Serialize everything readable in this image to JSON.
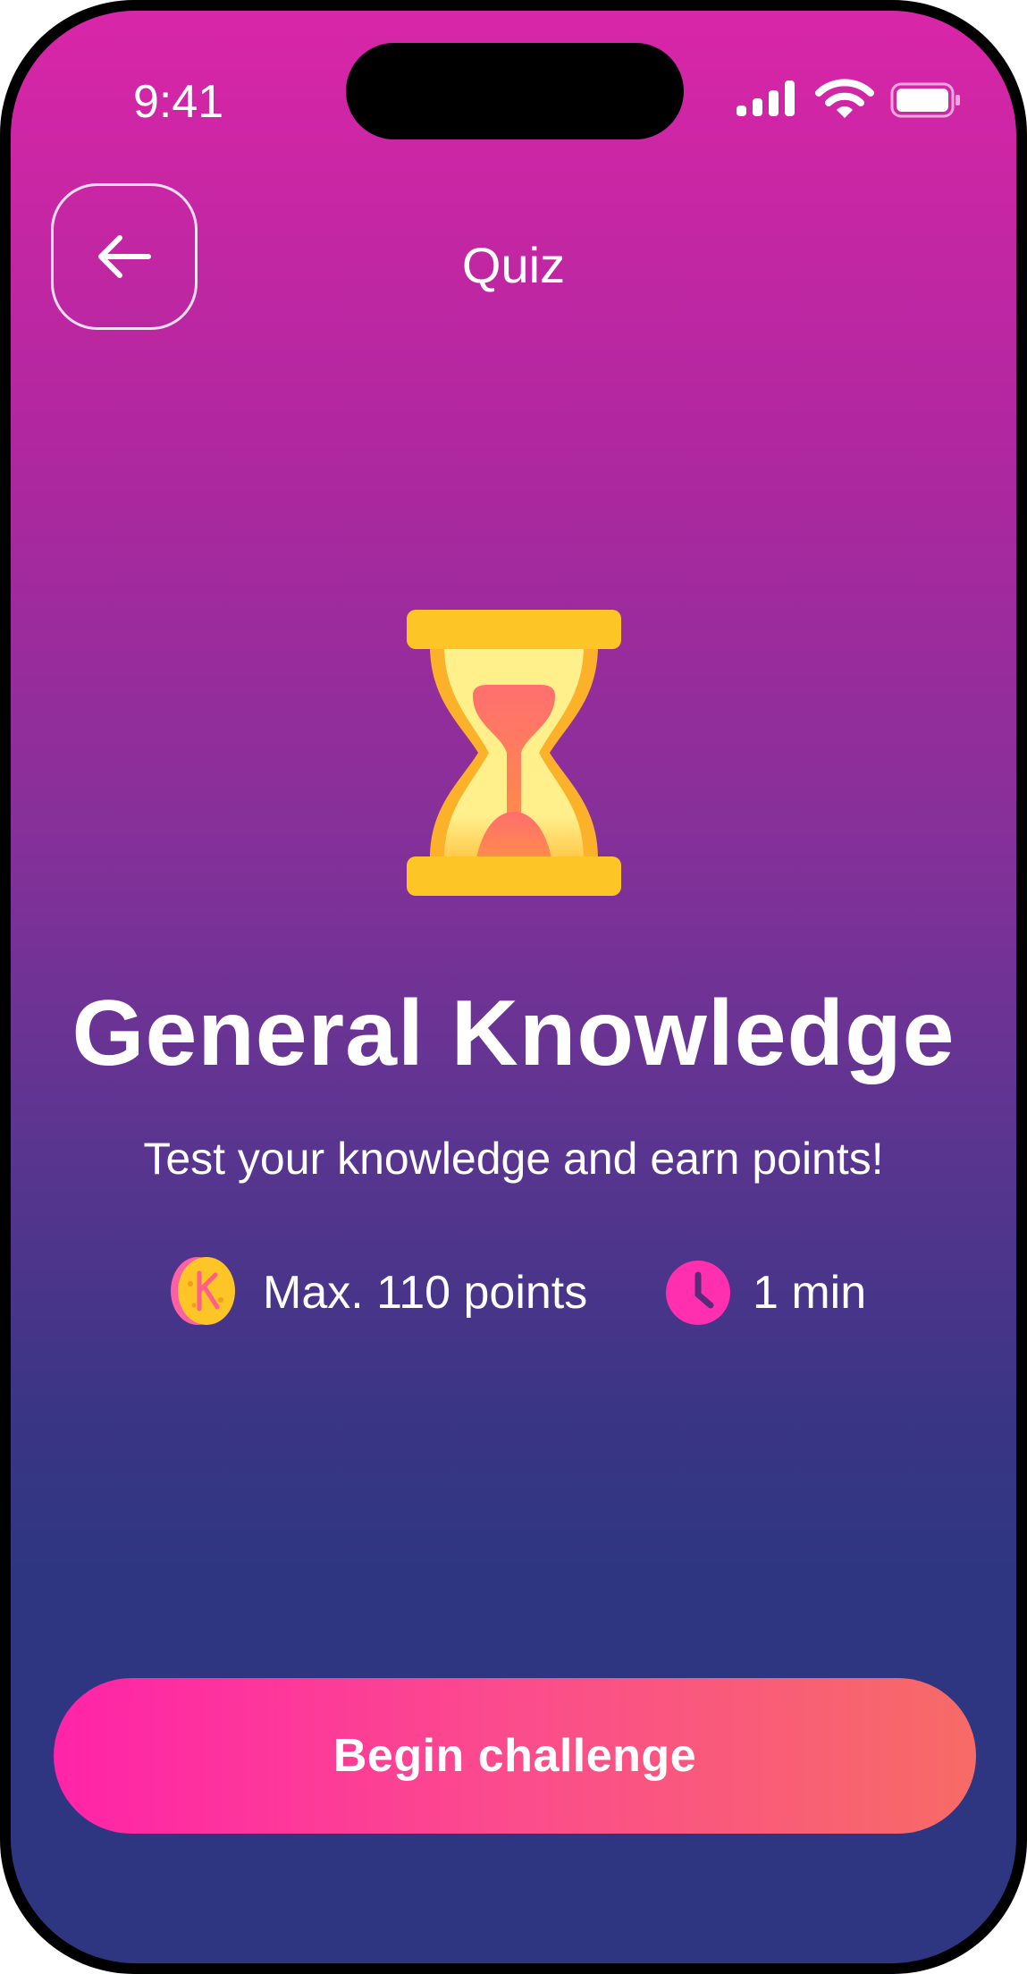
{
  "status_bar": {
    "time": "9:41",
    "icons": [
      "signal-icon",
      "wifi-icon",
      "battery-icon"
    ]
  },
  "header": {
    "back_icon": "arrow-left-icon",
    "title": "Quiz"
  },
  "hero": {
    "icon": "hourglass-icon"
  },
  "quiz": {
    "title": "General Knowledge",
    "subtitle": "Test your knowledge and earn points!",
    "points_icon": "coin-icon",
    "points_label": "Max. 110 points",
    "time_icon": "clock-icon",
    "time_label": "1 min"
  },
  "cta": {
    "label": "Begin challenge"
  },
  "colors": {
    "background_top": "#d926a8",
    "background_bottom": "#2e3682",
    "button_start": "#ff24a8",
    "button_end": "#f76b66",
    "hourglass_frame": "#fdc526",
    "clock": "#ff2fb0"
  }
}
